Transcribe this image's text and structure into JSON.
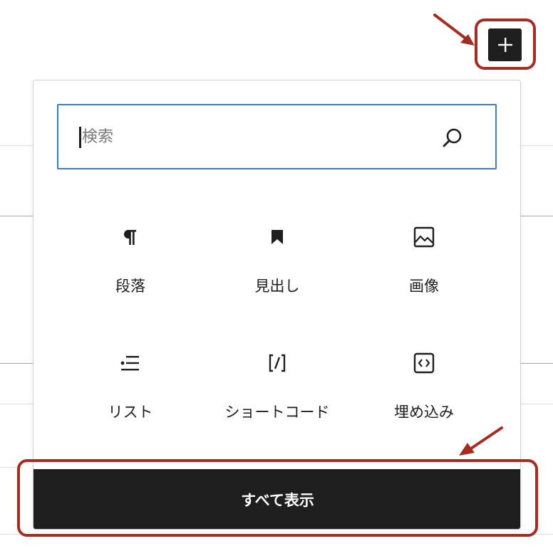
{
  "toolbar": {
    "add_block_label": "+"
  },
  "inserter": {
    "search": {
      "placeholder": "検索"
    },
    "blocks": [
      {
        "label": "段落",
        "icon": "paragraph-icon"
      },
      {
        "label": "見出し",
        "icon": "bookmark-icon"
      },
      {
        "label": "画像",
        "icon": "image-icon"
      },
      {
        "label": "リスト",
        "icon": "list-icon"
      },
      {
        "label": "ショートコード",
        "icon": "shortcode-icon"
      },
      {
        "label": "埋め込み",
        "icon": "embed-icon"
      }
    ],
    "show_all_label": "すべて表示"
  },
  "colors": {
    "accent": "#3f7fb6",
    "dark": "#1e1e1e",
    "highlight": "#a32d22"
  }
}
